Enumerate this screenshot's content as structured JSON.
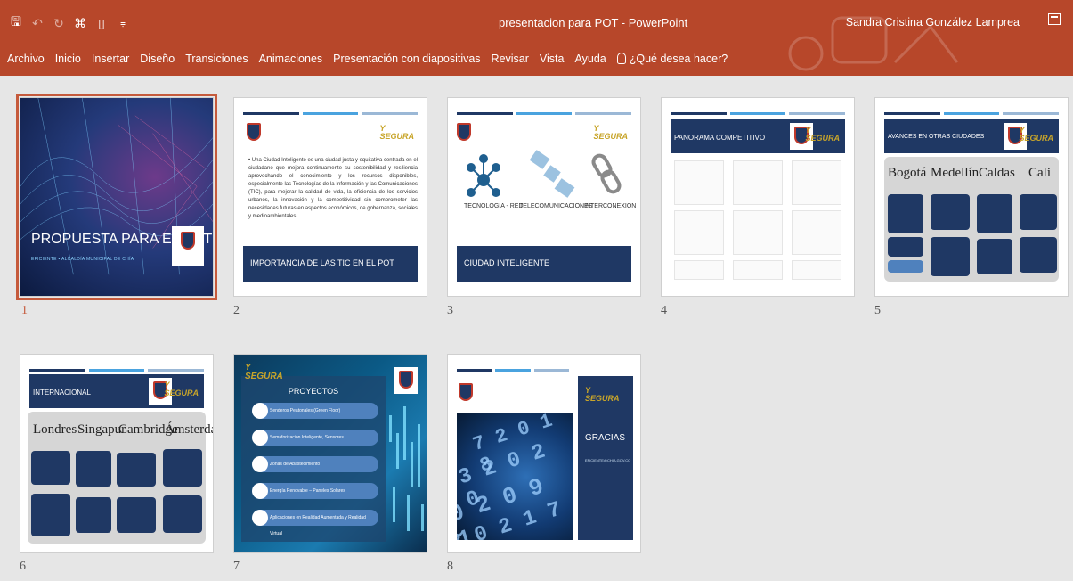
{
  "window": {
    "title": "presentacion para POT  -  PowerPoint",
    "user": "Sandra Cristina González Lamprea"
  },
  "menu": {
    "items": [
      "Archivo",
      "Inicio",
      "Insertar",
      "Diseño",
      "Transiciones",
      "Animaciones",
      "Presentación con diapositivas",
      "Revisar",
      "Vista",
      "Ayuda"
    ],
    "tell_me": "¿Qué desea hacer?"
  },
  "slides": [
    {
      "number": "1",
      "selected": true,
      "title": "PROPUESTA PARA EL POT",
      "subtitle": "EFICIENTE • ALCALDÍA MUNICIPAL DE CHÍA"
    },
    {
      "number": "2",
      "footer": "IMPORTANCIA DE LAS TIC EN EL POT",
      "body": "• Una Ciudad Inteligente es una ciudad justa y equitativa centrada en el ciudadano que mejora continuamente su sostenibilidad y resiliencia aprovechando el conocimiento y los recursos disponibles, especialmente las Tecnologías de la Información y las Comunicaciones (TIC), para mejorar la calidad de vida, la eficiencia de los servicios urbanos, la innovación y la competitividad sin comprometer las necesidades futuras en aspectos económicos, de gobernanza, sociales y medioambientales."
    },
    {
      "number": "3",
      "footer": "CIUDAD INTELIGENTE",
      "icons": [
        "TECNOLOGIA - RED",
        "TELECOMUNICACIONES",
        "INTERCONEXION"
      ]
    },
    {
      "number": "4",
      "title": "PANORAMA COMPETITIVO"
    },
    {
      "number": "5",
      "title": "AVANCES EN OTRAS CIUDADES",
      "cities": [
        "Bogotá",
        "Medellín",
        "Caldas",
        "Cali"
      ]
    },
    {
      "number": "6",
      "title": "INTERNACIONAL",
      "cities": [
        "Londres",
        "Singapur",
        "Cambridge",
        "Ámsterdam"
      ]
    },
    {
      "number": "7",
      "title": "PROYECTOS",
      "items": [
        "Senderos Peatonales (Green Floor)",
        "Semaforización Inteligente, Sensores",
        "Zonas de Abastecimiento",
        "Energía Renovable – Paneles Solares",
        "Aplicaciones en Realidad Aumentada y Realidad Virtual"
      ]
    },
    {
      "number": "8",
      "title": "GRACIAS",
      "subtitle": "EFICIENTE@CHIA.GOV.CO"
    }
  ]
}
